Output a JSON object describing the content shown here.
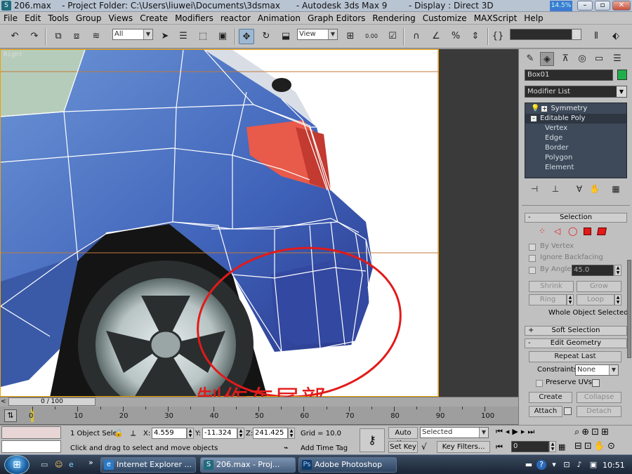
{
  "titlebar": {
    "app_icon": "3ds-max-icon",
    "title": "206.max    - Project Folder: C:\\Users\\liuwei\\Documents\\3dsmax      - Autodesk 3ds Max 9        - Display : Direct 3D",
    "cpu_meter": "14.5%"
  },
  "menu": [
    "File",
    "Edit",
    "Tools",
    "Group",
    "Views",
    "Create",
    "Modifiers",
    "reactor",
    "Animation",
    "Graph Editors",
    "Rendering",
    "Customize",
    "MAXScript",
    "Help"
  ],
  "toolbar": {
    "selection_filter": "All",
    "ref_coord": "View",
    "snap_value": "0.00",
    "named_selection": ""
  },
  "viewport": {
    "label": "Right",
    "caption": "制作车尾部",
    "accent_color": "#e21a1a",
    "border_color": "#f0a000"
  },
  "panel": {
    "tabs": [
      "create-tab",
      "modify-tab",
      "hierarchy-tab",
      "motion-tab",
      "display-tab",
      "utilities-tab"
    ],
    "object_name": "Box01",
    "object_color": "#1faf4a",
    "modifier_list": "Modifier List",
    "stack": [
      {
        "label": "Symmetry",
        "sub": false
      },
      {
        "label": "Editable Poly",
        "sub": false
      },
      {
        "label": "Vertex",
        "sub": true
      },
      {
        "label": "Edge",
        "sub": true
      },
      {
        "label": "Border",
        "sub": true
      },
      {
        "label": "Polygon",
        "sub": true
      },
      {
        "label": "Element",
        "sub": true
      }
    ],
    "selection": {
      "title": "Selection",
      "by_vertex": "By Vertex",
      "ignore_backfacing": "Ignore Backfacing",
      "by_angle": "By Angle",
      "angle_value": "45.0",
      "shrink": "Shrink",
      "grow": "Grow",
      "ring": "Ring",
      "loop": "Loop",
      "status": "Whole Object Selected"
    },
    "soft_selection": {
      "title": "Soft Selection"
    },
    "edit_geometry": {
      "title": "Edit Geometry",
      "repeat_last": "Repeat Last",
      "constraints_label": "Constraints:",
      "constraints_value": "None",
      "preserve_uvs": "Preserve UVs",
      "create": "Create",
      "collapse": "Collapse",
      "attach": "Attach",
      "detach": "Detach"
    }
  },
  "timeline": {
    "frame": "0 / 100",
    "ticks": [
      "0",
      "10",
      "20",
      "30",
      "40",
      "50",
      "60",
      "70",
      "80",
      "90",
      "100"
    ]
  },
  "status": {
    "selection_count": "1 Object Sele",
    "x_label": "X:",
    "x_value": "4.559",
    "y_label": "Y:",
    "y_value": "-11.324",
    "z_label": "Z:",
    "z_value": "241.425",
    "grid": "Grid = 10.0",
    "prompt": "Click and drag to select and move objects",
    "add_time_tag": "Add Time Tag",
    "auto_key": "Auto Key",
    "set_key": "Set Key",
    "key_mode": "Selected",
    "key_filters": "Key Filters...",
    "current_frame": "0"
  },
  "taskbar": {
    "tasks": [
      {
        "label": "Internet Explorer ...",
        "icon": "ie-icon"
      },
      {
        "label": "206.max       - Proj...",
        "icon": "3ds-max-icon"
      },
      {
        "label": "Adobe Photoshop",
        "icon": "photoshop-icon"
      }
    ],
    "clock": "10:51"
  }
}
